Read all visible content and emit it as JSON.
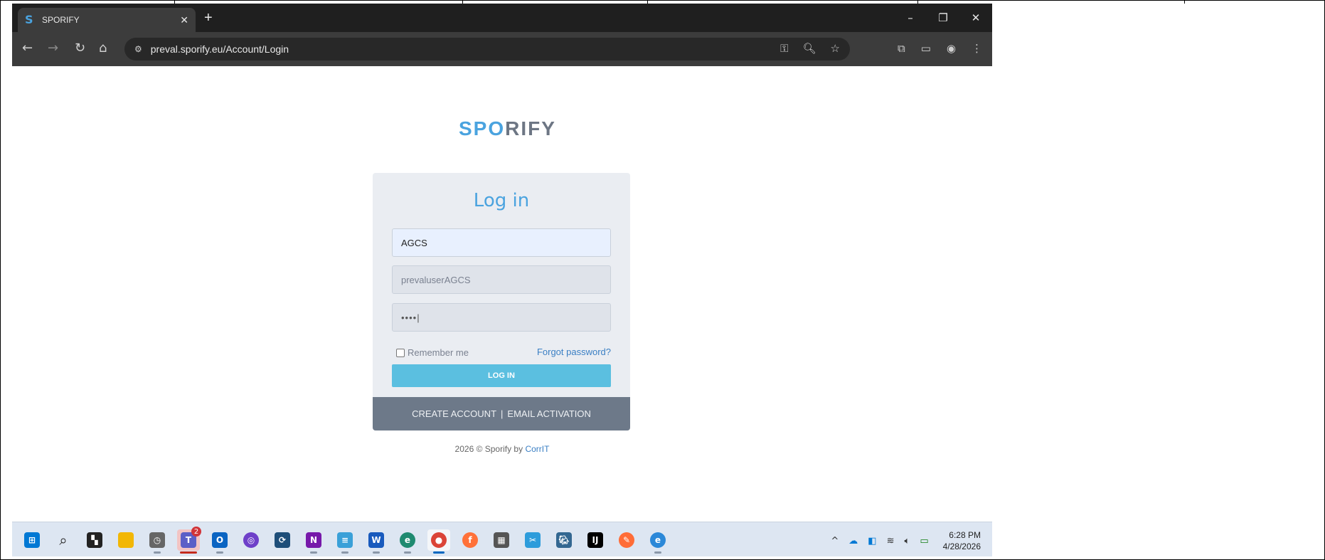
{
  "browser": {
    "tab_title": "SPORIFY",
    "tab_logo_letter": "S",
    "url": "preval.sporify.eu/Account/Login",
    "window_controls": [
      "–",
      "❐",
      "✕"
    ]
  },
  "page": {
    "brand_left": "SP",
    "brand_mid": "O",
    "brand_right": "RIFY",
    "login_title": "Log in",
    "tenant_value": "AGCS",
    "username_value": "prevaluserAGCS",
    "password_mask": "••••|",
    "remember_label": "Remember me",
    "forgot_label": "Forgot password?",
    "login_button": "LOG IN",
    "create_account": "CREATE ACCOUNT",
    "separator": "|",
    "email_activation": "EMAIL ACTIVATION",
    "copyright_prefix": "2026 © Sporify by ",
    "copyright_link": "CorrIT"
  },
  "taskbar": {
    "teams_badge": "2",
    "time": "6:28 PM",
    "date": "4/28/2026"
  },
  "colors": {
    "accent": "#4aa3df",
    "login_button": "#5bbfe0",
    "card_footer": "#6d7989"
  }
}
